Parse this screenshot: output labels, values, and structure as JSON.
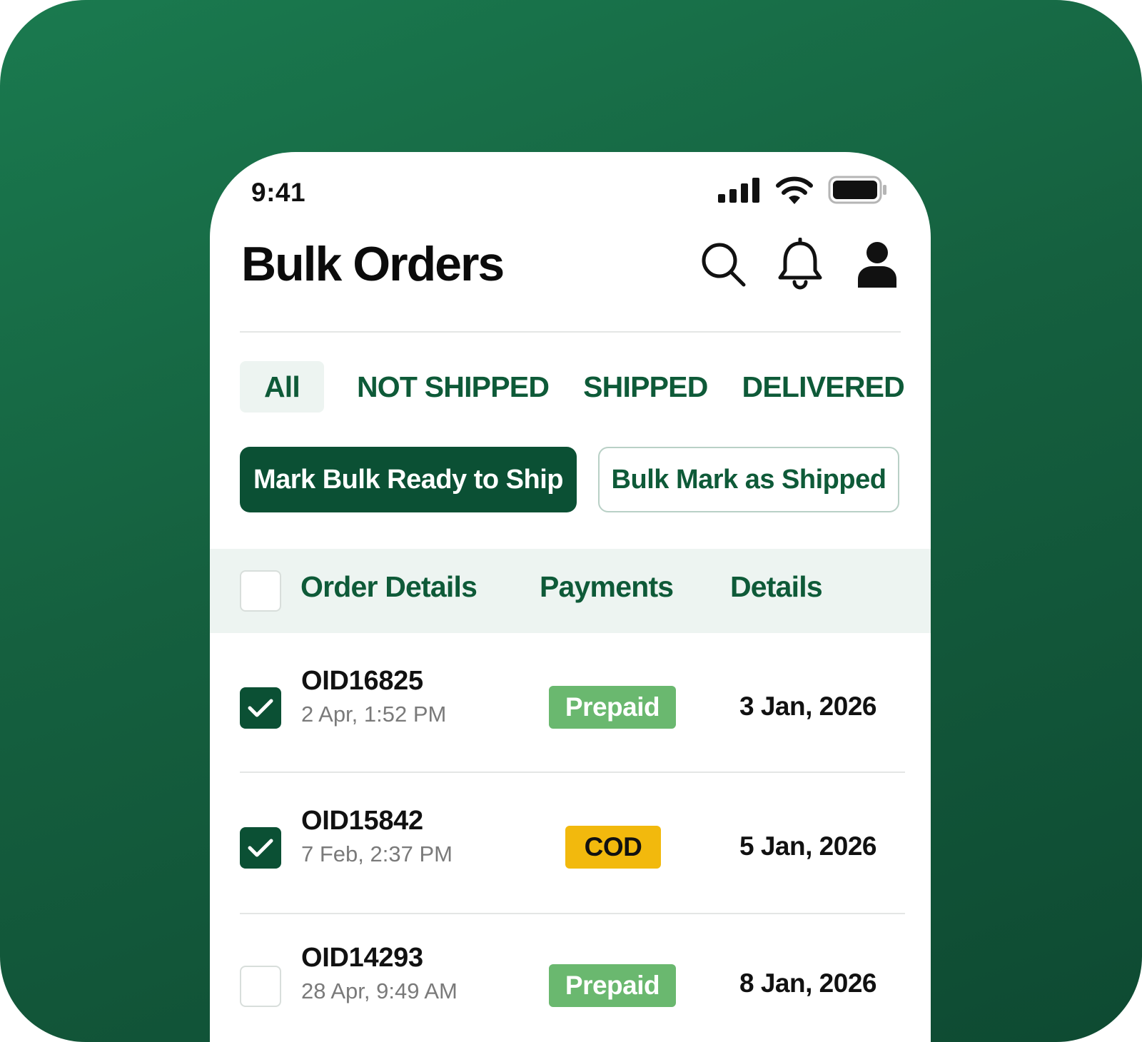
{
  "status_bar": {
    "time": "9:41"
  },
  "header": {
    "title": "Bulk Orders"
  },
  "tabs": [
    {
      "label": "All",
      "active": true
    },
    {
      "label": "NOT SHIPPED",
      "active": false
    },
    {
      "label": "SHIPPED",
      "active": false
    },
    {
      "label": "DELIVERED",
      "active": false
    }
  ],
  "actions": {
    "primary_label": "Mark Bulk Ready to Ship",
    "secondary_label": "Bulk Mark as Shipped"
  },
  "table": {
    "columns": [
      "Order Details",
      "Payments",
      "Details"
    ],
    "select_all_checked": false,
    "rows": [
      {
        "checked": true,
        "order_id": "OID16825",
        "order_time": "2 Apr, 1:52 PM",
        "payment": "Prepaid",
        "payment_type": "prepaid",
        "date": "3 Jan, 2026"
      },
      {
        "checked": true,
        "order_id": "OID15842",
        "order_time": "7 Feb, 2:37 PM",
        "payment": "COD",
        "payment_type": "cod",
        "date": "5 Jan, 2026"
      },
      {
        "checked": false,
        "order_id": "OID14293",
        "order_time": "28 Apr, 9:49 AM",
        "payment": "Prepaid",
        "payment_type": "prepaid",
        "date": "8 Jan, 2026"
      }
    ]
  },
  "colors": {
    "brand_dark": "#0b5034",
    "brand_text": "#0e5a38",
    "prepaid_badge": "#6ab86f",
    "cod_badge": "#f2b90d",
    "table_header_bg": "#edf4f1"
  },
  "icons": [
    "signal-icon",
    "wifi-icon",
    "battery-icon",
    "search-icon",
    "bell-icon",
    "user-icon",
    "checkmark-icon"
  ]
}
